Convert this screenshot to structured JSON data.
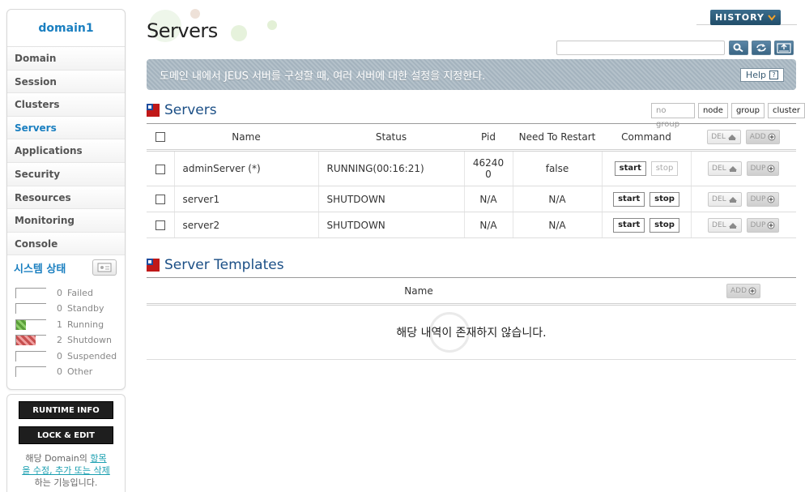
{
  "sidebar": {
    "domain": "domain1",
    "items": [
      {
        "label": "Domain"
      },
      {
        "label": "Session"
      },
      {
        "label": "Clusters"
      },
      {
        "label": "Servers"
      },
      {
        "label": "Applications"
      },
      {
        "label": "Security"
      },
      {
        "label": "Resources"
      },
      {
        "label": "Monitoring"
      },
      {
        "label": "Console"
      }
    ],
    "active_index": 3,
    "system_status": {
      "title": "시스템 상태",
      "rows": [
        {
          "count": "0",
          "label": "Failed"
        },
        {
          "count": "0",
          "label": "Standby"
        },
        {
          "count": "1",
          "label": "Running"
        },
        {
          "count": "2",
          "label": "Shutdown"
        },
        {
          "count": "0",
          "label": "Suspended"
        },
        {
          "count": "0",
          "label": "Other"
        }
      ]
    },
    "runtime_info": "RUNTIME INFO",
    "lock_edit": "LOCK & EDIT",
    "note": {
      "part1": "해당 Domain의 ",
      "link": "항목을 수정, 추가 또는 삭제",
      "part2": "하는 기능입니다."
    }
  },
  "header": {
    "title": "Servers",
    "history": "HISTORY",
    "search_value": ""
  },
  "banner": {
    "text": "도메인 내에서 JEUS 서버를 구성할 때, 여러 서버에 대한 설정을 지정한다.",
    "help": "Help"
  },
  "servers": {
    "title": "Servers",
    "filters": [
      "no group",
      "node",
      "group",
      "cluster"
    ],
    "columns": {
      "name": "Name",
      "status": "Status",
      "pid": "Pid",
      "restart": "Need To Restart",
      "command": "Command"
    },
    "del": "DEL",
    "add": "ADD",
    "dup": "DUP",
    "start": "start",
    "stop": "stop",
    "rows": [
      {
        "name": "adminServer (*)",
        "status": "RUNNING(00:16:21)",
        "pid_1": "46240",
        "pid_2": "0",
        "restart": "false"
      },
      {
        "name": "server1",
        "status": "SHUTDOWN",
        "pid": "N/A",
        "restart": "N/A"
      },
      {
        "name": "server2",
        "status": "SHUTDOWN",
        "pid": "N/A",
        "restart": "N/A"
      }
    ]
  },
  "templates": {
    "title": "Server Templates",
    "column_name": "Name",
    "add": "ADD",
    "empty": "해당 내역이 존재하지 않습니다."
  },
  "colors": {
    "accent": "#1a7fc0",
    "section_title": "#1b4f86",
    "banner": "#a4b3be",
    "history": "#2d5a78"
  }
}
